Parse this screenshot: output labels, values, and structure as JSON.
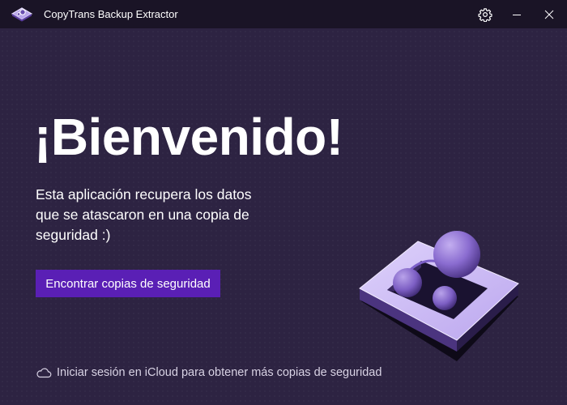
{
  "window": {
    "title": "CopyTrans Backup Extractor",
    "icons": {
      "logo": "copytrans-logo-icon",
      "settings": "gear-icon",
      "minimize": "minimize-icon",
      "close": "close-icon"
    }
  },
  "main": {
    "welcome_title": "¡Bienvenido!",
    "description": "Esta aplicación recupera los datos que se atascaron en una copia de seguridad :)",
    "find_button_label": "Encontrar copias de seguridad",
    "icloud_link_text": "Iniciar sesión en iCloud para obtener más copias de seguridad",
    "icloud_icon": "cloud-icon"
  },
  "colors": {
    "background": "#2d2342",
    "titlebar": "#1a1426",
    "accent_button": "#5a1fb5",
    "illustration_tile": "#c9b8ef"
  }
}
